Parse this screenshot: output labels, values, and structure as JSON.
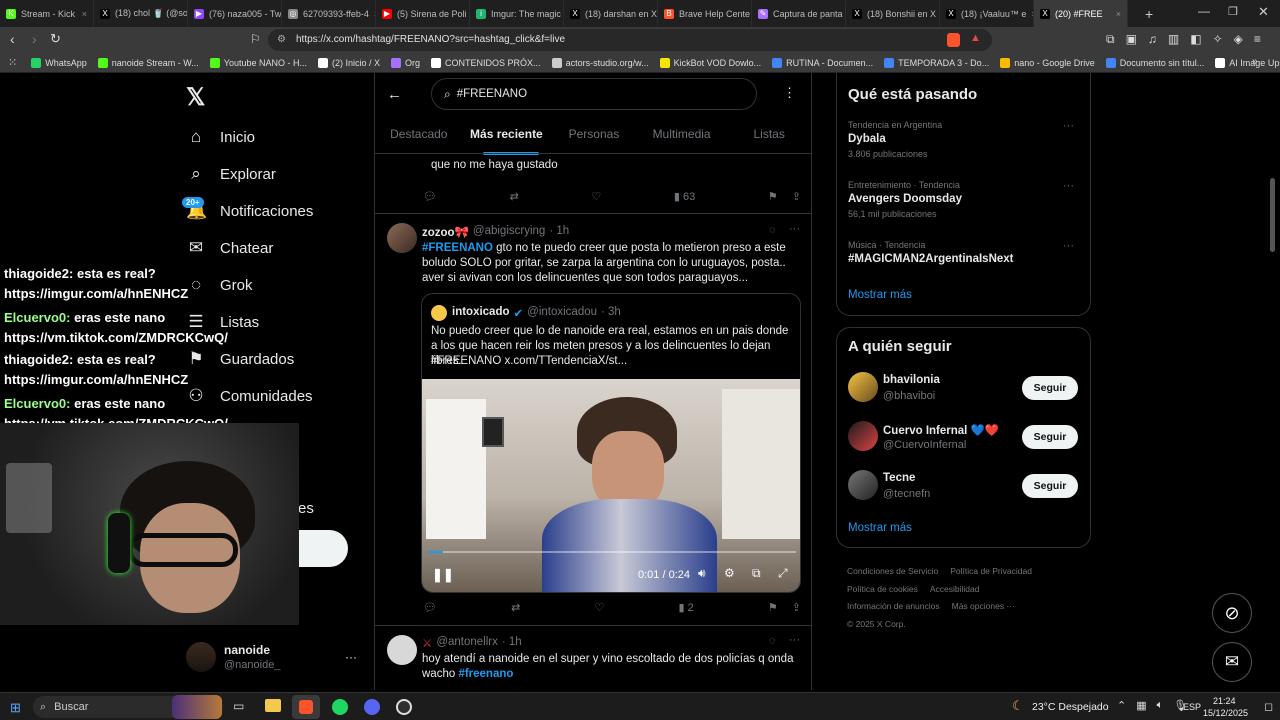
{
  "browser": {
    "tabs": [
      {
        "label": "Stream - Kick",
        "color": "#53fc18",
        "glyph": "K"
      },
      {
        "label": "(18) chol 🥤 (@so",
        "color": "#000000",
        "glyph": "X"
      },
      {
        "label": "(76) naza005 - Tw",
        "color": "#9146ff",
        "glyph": "▶"
      },
      {
        "label": "62709393-ffeb-4",
        "color": "#888888",
        "glyph": "◎"
      },
      {
        "label": "(5) Sirena de Poli",
        "color": "#ff0000",
        "glyph": "▶"
      },
      {
        "label": "Imgur: The magic",
        "color": "#1bb76e",
        "glyph": "i"
      },
      {
        "label": "(18) darshan en X",
        "color": "#000000",
        "glyph": "X"
      },
      {
        "label": "Brave Help Cente",
        "color": "#fb542b",
        "glyph": "B"
      },
      {
        "label": "Captura de panta",
        "color": "#a970ff",
        "glyph": "✎"
      },
      {
        "label": "(18) Bonshii en X",
        "color": "#000000",
        "glyph": "X"
      },
      {
        "label": "(18) ¡Vaaluu™ e",
        "color": "#000000",
        "glyph": "X"
      },
      {
        "label": "(20) #FREE",
        "color": "#000000",
        "glyph": "X"
      }
    ],
    "url": "https://x.com/hashtag/FREENANO?src=hashtag_click&f=live",
    "bookmarks": [
      {
        "label": "WhatsApp",
        "color": "#25d366"
      },
      {
        "label": "nanoide Stream - W...",
        "color": "#53fc18"
      },
      {
        "label": "Youtube NANO - H...",
        "color": "#53fc18"
      },
      {
        "label": "(2) Inicio / X",
        "color": "#ffffff"
      },
      {
        "label": "Org",
        "color": "#a970ff"
      },
      {
        "label": "CONTENIDOS PRÓX...",
        "color": "#ffffff"
      },
      {
        "label": "actors-studio.org/w...",
        "color": "#cccccc"
      },
      {
        "label": "KickBot VOD Dowlo...",
        "color": "#f7e600"
      },
      {
        "label": "RUTINA - Documen...",
        "color": "#4285f4"
      },
      {
        "label": "TEMPORADA 3 - Do...",
        "color": "#4285f4"
      },
      {
        "label": "nano - Google Drive",
        "color": "#fbbc04"
      },
      {
        "label": "Documento sin títul...",
        "color": "#4285f4"
      },
      {
        "label": "AI Image Upscaler |...",
        "color": "#ffffff"
      }
    ]
  },
  "sidebar": {
    "nav": [
      {
        "label": "Inicio",
        "icon": "home-icon",
        "glyph": "⌂"
      },
      {
        "label": "Explorar",
        "icon": "search-icon",
        "glyph": "⌕"
      },
      {
        "label": "Notificaciones",
        "icon": "bell-icon",
        "glyph": "🔔"
      },
      {
        "label": "Chatear",
        "icon": "mail-icon",
        "glyph": "✉"
      },
      {
        "label": "Grok",
        "icon": "grok-icon",
        "glyph": "◌"
      },
      {
        "label": "Listas",
        "icon": "list-icon",
        "glyph": "☰"
      },
      {
        "label": "Guardados",
        "icon": "bookmark-icon",
        "glyph": "⚑"
      },
      {
        "label": "Comunidades",
        "icon": "people-icon",
        "glyph": "⚇"
      }
    ],
    "notif_badge": "20+",
    "account": {
      "name": "nanoide",
      "handle": "@nanoide_"
    }
  },
  "chat": [
    {
      "user": "thiagoide2:",
      "msg": "esta es real?",
      "link": "https://imgur.com/a/hnENHCZ",
      "color": "#ffffff"
    },
    {
      "user": "Elcuervo0:",
      "msg": "eras este nano",
      "link": "https://vm.tiktok.com/ZMDRCKCwQ/",
      "color": "#9bff8a"
    },
    {
      "user": "thiagoide2:",
      "msg": "esta es real?",
      "link": "https://imgur.com/a/hnENHCZ",
      "color": "#ffffff"
    },
    {
      "user": "Elcuervo0:",
      "msg": "eras este nano",
      "link": "https://vm.tiktok.com/ZMDRCKCwQ/",
      "color": "#9bff8a"
    }
  ],
  "feed": {
    "search_value": "#FREENANO",
    "tabs": [
      "Destacado",
      "Más reciente",
      "Personas",
      "Multimedia",
      "Listas"
    ],
    "prev_tweet": {
      "text": "que no me haya gustado",
      "views": "63"
    },
    "tweet1": {
      "name": "zozoo🎀",
      "handle": "@abigiscrying",
      "time": "· 1h",
      "hashtag": "#FREENANO",
      "text": " gto no te puedo creer que posta lo metieron preso a este boludo SOLO por gritar, se zarpa la argentina con lo uruguayos, posta.. aver si avivan con los delincuentes que son todos paraguayos...",
      "quote": {
        "name": "intoxicado",
        "handle": "@intoxicadou",
        "time": "· 3h",
        "text": "No puedo creer que lo de nanoide era real, estamos en un pais donde a los que hacen reir los meten presos y a los delincuentes lo dejan libres.",
        "text2": "#FREENANO  x.com/TTendenciaX/st..."
      },
      "video_time": "0:01 / 0:24",
      "views": "2"
    },
    "tweet2": {
      "handle": "@antonellrx",
      "time": "· 1h",
      "text": "hoy atendí a nanoide en el super y vino escoltado de dos policías q onda wacho ",
      "hashtag": "#freenano"
    }
  },
  "right": {
    "trends_title": "Qué está pasando",
    "trends": [
      {
        "cat": "Tendencia en Argentina",
        "name": "Dybala",
        "count": "3.806 publicaciones"
      },
      {
        "cat": "Entretenimiento · Tendencia",
        "name": "Avengers Doomsday",
        "count": "56,1 mil publicaciones"
      },
      {
        "cat": "Música · Tendencia",
        "name": "#MAGICMAN2ArgentinaIsNext",
        "count": ""
      }
    ],
    "show_more": "Mostrar más",
    "follow_title": "A quién seguir",
    "follow": [
      {
        "name": "bhavilonia",
        "handle": "@bhaviboi",
        "button": "Seguir"
      },
      {
        "name": "Cuervo Infernal 💙❤️",
        "handle": "@CuervoInfernal",
        "button": "Seguir"
      },
      {
        "name": "Tecne",
        "handle": "@tecnefn",
        "button": "Seguir"
      }
    ],
    "footer": [
      "Condiciones de Servicio",
      "Política de Privacidad",
      "Política de cookies",
      "Accesibilidad",
      "Información de anuncios",
      "Más opciones ···",
      "© 2025 X Corp."
    ]
  },
  "taskbar": {
    "search": "Buscar",
    "weather": "23°C  Despejado",
    "lang": "ESP",
    "time": "21:24",
    "date": "15/12/2025"
  }
}
